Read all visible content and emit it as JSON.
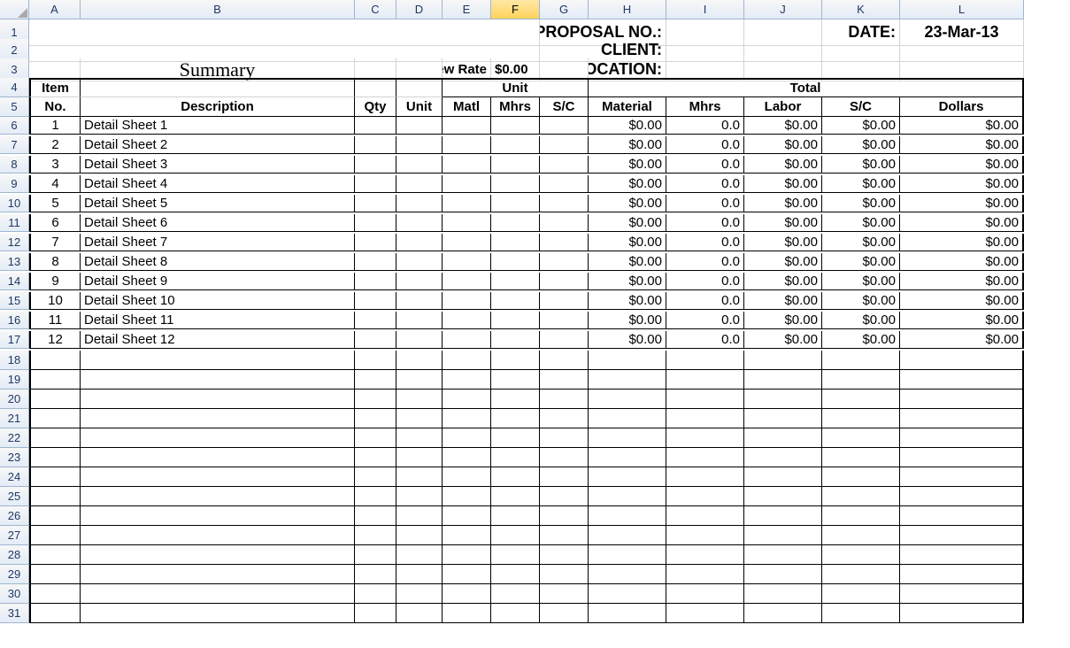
{
  "columns": [
    "A",
    "B",
    "C",
    "D",
    "E",
    "F",
    "G",
    "H",
    "I",
    "J",
    "K",
    "L"
  ],
  "active_column": "F",
  "header": {
    "proposal_label": "PROPOSAL NO.:",
    "date_label": "DATE:",
    "date_value": "23-Mar-13",
    "client_label": "CLIENT:",
    "location_label": "LOCATION:",
    "summary_title": "Summary",
    "crew_rate_label": "Crew Rate",
    "crew_rate_value": "$0.00"
  },
  "table_headers": {
    "item_no_line1": "Item",
    "item_no_line2": "No.",
    "description": "Description",
    "qty": "Qty",
    "unit_col": "Unit",
    "unit_group": "Unit",
    "unit_matl": "Matl",
    "unit_mhrs": "Mhrs",
    "unit_sc": "S/C",
    "total_group": "Total",
    "total_material": "Material",
    "total_mhrs": "Mhrs",
    "total_labor": "Labor",
    "total_sc": "S/C",
    "total_dollars": "Dollars"
  },
  "rows": [
    {
      "no": "1",
      "desc": "Detail Sheet 1",
      "material": "$0.00",
      "mhrs": "0.0",
      "labor": "$0.00",
      "sc": "$0.00",
      "dollars": "$0.00"
    },
    {
      "no": "2",
      "desc": "Detail Sheet 2",
      "material": "$0.00",
      "mhrs": "0.0",
      "labor": "$0.00",
      "sc": "$0.00",
      "dollars": "$0.00"
    },
    {
      "no": "3",
      "desc": "Detail Sheet 3",
      "material": "$0.00",
      "mhrs": "0.0",
      "labor": "$0.00",
      "sc": "$0.00",
      "dollars": "$0.00"
    },
    {
      "no": "4",
      "desc": "Detail Sheet 4",
      "material": "$0.00",
      "mhrs": "0.0",
      "labor": "$0.00",
      "sc": "$0.00",
      "dollars": "$0.00"
    },
    {
      "no": "5",
      "desc": "Detail Sheet 5",
      "material": "$0.00",
      "mhrs": "0.0",
      "labor": "$0.00",
      "sc": "$0.00",
      "dollars": "$0.00"
    },
    {
      "no": "6",
      "desc": "Detail Sheet 6",
      "material": "$0.00",
      "mhrs": "0.0",
      "labor": "$0.00",
      "sc": "$0.00",
      "dollars": "$0.00"
    },
    {
      "no": "7",
      "desc": "Detail Sheet 7",
      "material": "$0.00",
      "mhrs": "0.0",
      "labor": "$0.00",
      "sc": "$0.00",
      "dollars": "$0.00"
    },
    {
      "no": "8",
      "desc": "Detail Sheet 8",
      "material": "$0.00",
      "mhrs": "0.0",
      "labor": "$0.00",
      "sc": "$0.00",
      "dollars": "$0.00"
    },
    {
      "no": "9",
      "desc": "Detail Sheet 9",
      "material": "$0.00",
      "mhrs": "0.0",
      "labor": "$0.00",
      "sc": "$0.00",
      "dollars": "$0.00"
    },
    {
      "no": "10",
      "desc": "Detail Sheet 10",
      "material": "$0.00",
      "mhrs": "0.0",
      "labor": "$0.00",
      "sc": "$0.00",
      "dollars": "$0.00"
    },
    {
      "no": "11",
      "desc": "Detail Sheet 11",
      "material": "$0.00",
      "mhrs": "0.0",
      "labor": "$0.00",
      "sc": "$0.00",
      "dollars": "$0.00"
    },
    {
      "no": "12",
      "desc": "Detail Sheet 12",
      "material": "$0.00",
      "mhrs": "0.0",
      "labor": "$0.00",
      "sc": "$0.00",
      "dollars": "$0.00"
    }
  ],
  "empty_row_count": 14,
  "last_row_index": 31
}
